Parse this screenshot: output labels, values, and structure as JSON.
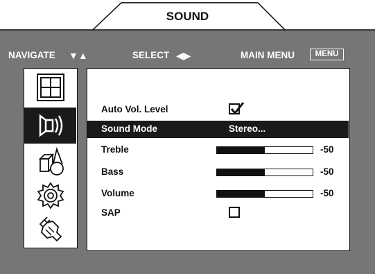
{
  "title": "SOUND",
  "hints": {
    "navigate_label": "NAVIGATE",
    "navigate_keys": "▼▲",
    "select_label": "SELECT",
    "select_keys": "◀▶",
    "main_menu_label": "MAIN MENU",
    "menu_key": "MENU"
  },
  "sidebar": {
    "items": [
      {
        "icon": "picture-grid-icon",
        "active": false
      },
      {
        "icon": "sound-speaker-icon",
        "active": true
      },
      {
        "icon": "shapes-icon",
        "active": false
      },
      {
        "icon": "gear-icon",
        "active": false
      },
      {
        "icon": "plug-icon",
        "active": false
      }
    ]
  },
  "settings": {
    "auto_vol": {
      "label": "Auto Vol. Level",
      "checked": true
    },
    "sound_mode": {
      "label": "Sound Mode",
      "value": "Stereo..."
    },
    "treble": {
      "label": "Treble",
      "value": "-50",
      "level": 0.5
    },
    "bass": {
      "label": "Bass",
      "value": "-50",
      "level": 0.5
    },
    "volume": {
      "label": "Volume",
      "value": "-50",
      "level": 0.5
    },
    "sap": {
      "label": "SAP",
      "checked": false
    }
  },
  "colors": {
    "frame": "#767676",
    "highlight": "#1a1a1a",
    "panel": "#ffffff"
  }
}
